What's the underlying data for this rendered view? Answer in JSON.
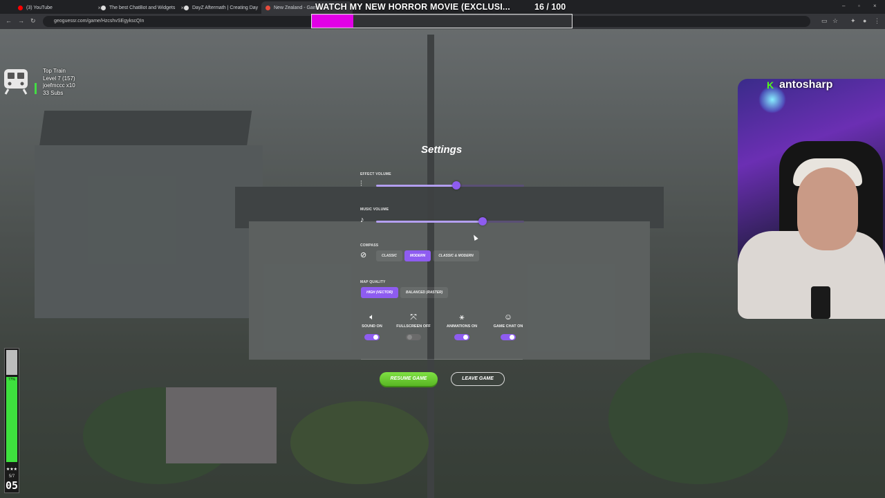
{
  "browser": {
    "tabs": [
      {
        "label": "(3) YouTube",
        "color": "#ff0000"
      },
      {
        "label": "The best ChatBot and Widgets",
        "color": "#dddddd"
      },
      {
        "label": "DayZ Aftermath | Creating Day",
        "color": "#dddddd"
      },
      {
        "label": "New Zealand - Game",
        "color": "#e74c3c"
      }
    ],
    "url": "geoguessr.com/game/HzcshvSEgykscQIn"
  },
  "stream": {
    "title": "WATCH MY NEW HORROR MOVIE (EXCLUSI...",
    "count": "16 / 100",
    "progress": 0.16,
    "progress_color": "#e100e6",
    "top_train": {
      "line1": "Top Train",
      "line2": "Level 7  (157)",
      "line3": "joefmccc x10",
      "line4": "33 Subs"
    },
    "meter": {
      "percent_label": "77%",
      "fill": 0.77,
      "stars": "★★★",
      "num_small": "5/7",
      "num_big": "05"
    },
    "webcam": {
      "streamer": "antosharp",
      "platform_icon": "kick-logo"
    }
  },
  "settings": {
    "title": "Settings",
    "effect_volume": {
      "label": "EFFECT VOLUME",
      "value": 0.54,
      "icon": "waveform-icon"
    },
    "music_volume": {
      "label": "MUSIC VOLUME",
      "value": 0.72,
      "icon": "music-note-icon"
    },
    "compass": {
      "label": "COMPASS",
      "options": [
        "CLASSIC",
        "MODERN",
        "CLASSIC & MODERN"
      ],
      "selected": "MODERN"
    },
    "map_quality": {
      "label": "MAP QUALITY",
      "options": [
        "HIGH (VECTOR)",
        "BALANCED (RASTER)"
      ],
      "selected": "HIGH (VECTOR)"
    },
    "toggles": [
      {
        "label": "SOUND ON",
        "on": true,
        "icon": "speaker-icon"
      },
      {
        "label": "FULLSCREEN OFF",
        "on": false,
        "icon": "fullscreen-icon"
      },
      {
        "label": "ANIMATIONS ON",
        "on": true,
        "icon": "running-icon"
      },
      {
        "label": "GAME CHAT ON",
        "on": true,
        "icon": "smiley-icon"
      }
    ],
    "resume_label": "RESUME GAME",
    "leave_label": "LEAVE GAME",
    "accent": "#8e5cf0",
    "resume_color": "#6fcf34"
  }
}
